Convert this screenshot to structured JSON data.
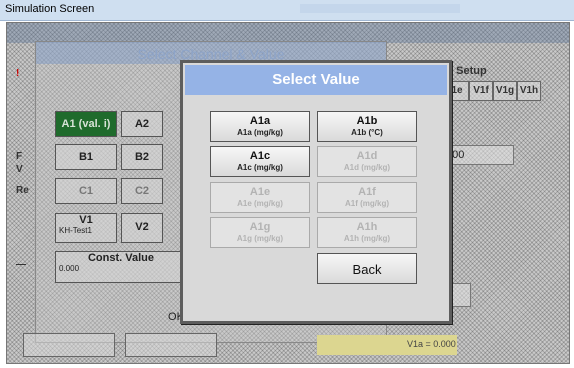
{
  "window": {
    "title": "Simulation Screen"
  },
  "background": {
    "channel_dialog_title": "Select Channel & Value",
    "setup_label": "e Setup",
    "tabs": [
      "1e",
      "V1f",
      "V1g",
      "V1h"
    ],
    "cells": [
      {
        "label": "A1 (val. i)"
      },
      {
        "label": "A2"
      },
      {
        "label": "B1"
      },
      {
        "label": "B2"
      },
      {
        "label": "C1"
      },
      {
        "label": "C2"
      },
      {
        "label": "V1",
        "sub": "KH-Test1"
      },
      {
        "label": "V2"
      }
    ],
    "const_value_label": "Const. Value",
    "const_value": "0.000",
    "field_value": ".000",
    "ok_label": "OK",
    "status_text": "V1a = 0.000",
    "left_marks": [
      "!",
      "F",
      "V",
      "Re",
      "—"
    ]
  },
  "dialog": {
    "title": "Select Value",
    "buttons": [
      {
        "label": "A1a",
        "sub": "A1a (mg/kg)",
        "enabled": true
      },
      {
        "label": "A1b",
        "sub": "A1b (°C)",
        "enabled": true
      },
      {
        "label": "A1c",
        "sub": "A1c (mg/kg)",
        "enabled": true
      },
      {
        "label": "A1d",
        "sub": "A1d (mg/kg)",
        "enabled": false
      },
      {
        "label": "A1e",
        "sub": "A1e (mg/kg)",
        "enabled": false
      },
      {
        "label": "A1f",
        "sub": "A1f (mg/kg)",
        "enabled": false
      },
      {
        "label": "A1g",
        "sub": "A1g (mg/kg)",
        "enabled": false
      },
      {
        "label": "A1h",
        "sub": "A1h (mg/kg)",
        "enabled": false
      }
    ],
    "back_label": "Back"
  },
  "colors": {
    "dialog_title_bg": "#95b3e6",
    "selected_cell": "#1f6b2c",
    "status_bar": "#dcd690"
  }
}
